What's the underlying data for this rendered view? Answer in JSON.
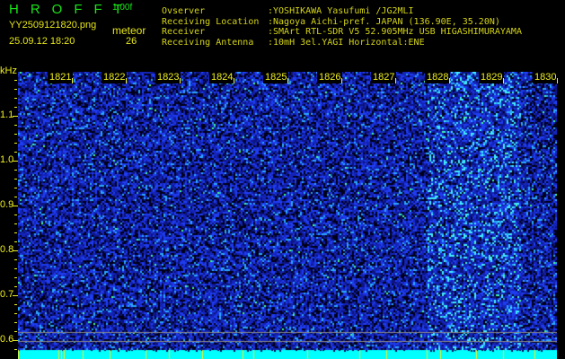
{
  "header": {
    "app_title": "HROFFT",
    "version": "1.00f",
    "filename": "YY2509121820.png",
    "datetime": "25.09.12 18:20",
    "meteor_label": "meteor",
    "meteor_count": "26"
  },
  "info": [
    {
      "label": "Ovserver",
      "value": ":YOSHIKAWA Yasufumi /JG2MLI"
    },
    {
      "label": "Receiving Location",
      "value": ":Nagoya Aichi-pref. JAPAN (136.90E, 35.20N)"
    },
    {
      "label": "Receiver",
      "value": ":SMArt RTL-SDR V5 52.905MHz USB HIGASHIMURAYAMA"
    },
    {
      "label": "Receiving Antenna",
      "value": ":10mH 3el.YAGI Horizontal:ENE"
    }
  ],
  "spectrogram": {
    "y_unit": "kHz",
    "y_ticks": [
      "1.1",
      "1.0",
      "0.9",
      "0.8",
      "0.7",
      "0.6"
    ],
    "time_labels": [
      "1821",
      "1822",
      "1823",
      "1824",
      "1825",
      "1826",
      "1827",
      "1828",
      "1829",
      "1830"
    ],
    "colors": {
      "background": "#000020",
      "noise": "#1a2fd0",
      "bright": "#30e0ff",
      "baseline": "#00ffff",
      "label": "#f0f020"
    }
  }
}
